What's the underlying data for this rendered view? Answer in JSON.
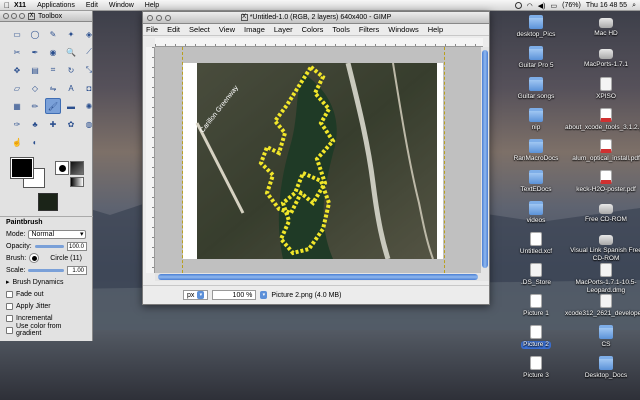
{
  "menubar": {
    "app_name": "X11",
    "items": [
      "Applications",
      "Edit",
      "Window",
      "Help"
    ],
    "clock": "Thu 16 48 55",
    "battery": "(76%)"
  },
  "toolbox": {
    "title": "Toolbox",
    "tool_icons": [
      "rect-select-icon",
      "ellipse-select-icon",
      "lasso-icon",
      "magic-wand-icon",
      "select-by-color-icon",
      "scissors-icon",
      "paths-icon",
      "color-picker-icon",
      "zoom-icon",
      "measure-icon",
      "move-icon",
      "align-icon",
      "crop-icon",
      "rotate-icon",
      "scale-icon",
      "shear-icon",
      "perspective-icon",
      "flip-icon",
      "text-icon",
      "bucket-fill-icon",
      "blend-icon",
      "pencil-icon",
      "paintbrush-icon",
      "eraser-icon",
      "airbrush-icon",
      "ink-icon",
      "clone-icon",
      "heal-icon",
      "perspective-clone-icon",
      "convolve-icon",
      "smudge-icon",
      "dodge-burn-icon"
    ],
    "tool_glyphs": [
      "▭",
      "◯",
      "✎",
      "✦",
      "◈",
      "✂",
      "✒",
      "◉",
      "🔍",
      "⟋",
      "✥",
      "▤",
      "⌗",
      "↻",
      "⤡",
      "▱",
      "◇",
      "⇋",
      "A",
      "◘",
      "▦",
      "✏",
      "🖌",
      "▬",
      "✺",
      "✑",
      "♣",
      "✚",
      "✿",
      "◍",
      "☝",
      "◐"
    ],
    "options": {
      "title": "Paintbrush",
      "mode_label": "Mode:",
      "mode_value": "Normal",
      "opacity_label": "Opacity:",
      "opacity_value": "100.0",
      "brush_label": "Brush:",
      "brush_value": "Circle (11)",
      "scale_label": "Scale:",
      "scale_value": "1.00",
      "brush_dynamics": "Brush Dynamics",
      "fade_out": "Fade out",
      "apply_jitter": "Apply Jitter",
      "incremental": "Incremental",
      "use_gradient": "Use color from gradient"
    }
  },
  "gimp": {
    "title": "*Untitled-1.0 (RGB, 2 layers) 640x400 - GIMP",
    "menu": [
      "File",
      "Edit",
      "Select",
      "View",
      "Image",
      "Layer",
      "Colors",
      "Tools",
      "Filters",
      "Windows",
      "Help"
    ],
    "unit": "px",
    "zoom": "100 %",
    "status": "Picture 2.png (4.0 MB)",
    "map_label": "Carillon Greenway"
  },
  "desktop": [
    {
      "label": "desktop_Pics",
      "type": "folder",
      "col": 0,
      "row": 0
    },
    {
      "label": "Mac HD",
      "type": "disk",
      "col": 1,
      "row": 0
    },
    {
      "label": "Guitar Pro 5",
      "type": "folder",
      "col": 0,
      "row": 1
    },
    {
      "label": "MacPorts-1.7.1",
      "type": "disk",
      "col": 1,
      "row": 1
    },
    {
      "label": "Guitar songs",
      "type": "folder",
      "col": 0,
      "row": 2
    },
    {
      "label": "XPISO",
      "type": "doc",
      "col": 1,
      "row": 2
    },
    {
      "label": "nip",
      "type": "folder",
      "col": 0,
      "row": 3
    },
    {
      "label": "about_xcode_tools_3.1.2.pdf",
      "type": "pdf",
      "col": 1,
      "row": 3
    },
    {
      "label": "RanMacroDocs",
      "type": "folder",
      "col": 0,
      "row": 4
    },
    {
      "label": "alum_optical_install.pdf",
      "type": "pdf",
      "col": 1,
      "row": 4
    },
    {
      "label": "TextEDocs",
      "type": "folder",
      "col": 0,
      "row": 5
    },
    {
      "label": "keck-H2O-poster.pdf",
      "type": "pdf",
      "col": 1,
      "row": 5
    },
    {
      "label": "videos",
      "type": "folder",
      "col": 0,
      "row": 6
    },
    {
      "label": "Free CD-ROM",
      "type": "disk",
      "col": 1,
      "row": 6
    },
    {
      "label": "Untitled.xcf",
      "type": "img",
      "col": 0,
      "row": 7
    },
    {
      "label": "Visual Link Spanish Free CD-ROM",
      "type": "disk",
      "col": 1,
      "row": 7
    },
    {
      "label": ".DS_Store",
      "type": "doc",
      "col": 0,
      "row": 8
    },
    {
      "label": "MacPorts-1.7.1-10.5-Leopard.dmg",
      "type": "doc",
      "col": 1,
      "row": 8
    },
    {
      "label": "Picture 1",
      "type": "img",
      "col": 0,
      "row": 9
    },
    {
      "label": "xcode312_2621_developerdvd.dmg",
      "type": "doc",
      "col": 1,
      "row": 9
    },
    {
      "label": "Picture 2",
      "type": "img",
      "col": 0,
      "row": 10,
      "selected": true
    },
    {
      "label": "CS",
      "type": "folder",
      "col": 1,
      "row": 10
    },
    {
      "label": "Picture 3",
      "type": "img",
      "col": 0,
      "row": 11
    },
    {
      "label": "Desktop_Docs",
      "type": "folder",
      "col": 1,
      "row": 11
    }
  ]
}
